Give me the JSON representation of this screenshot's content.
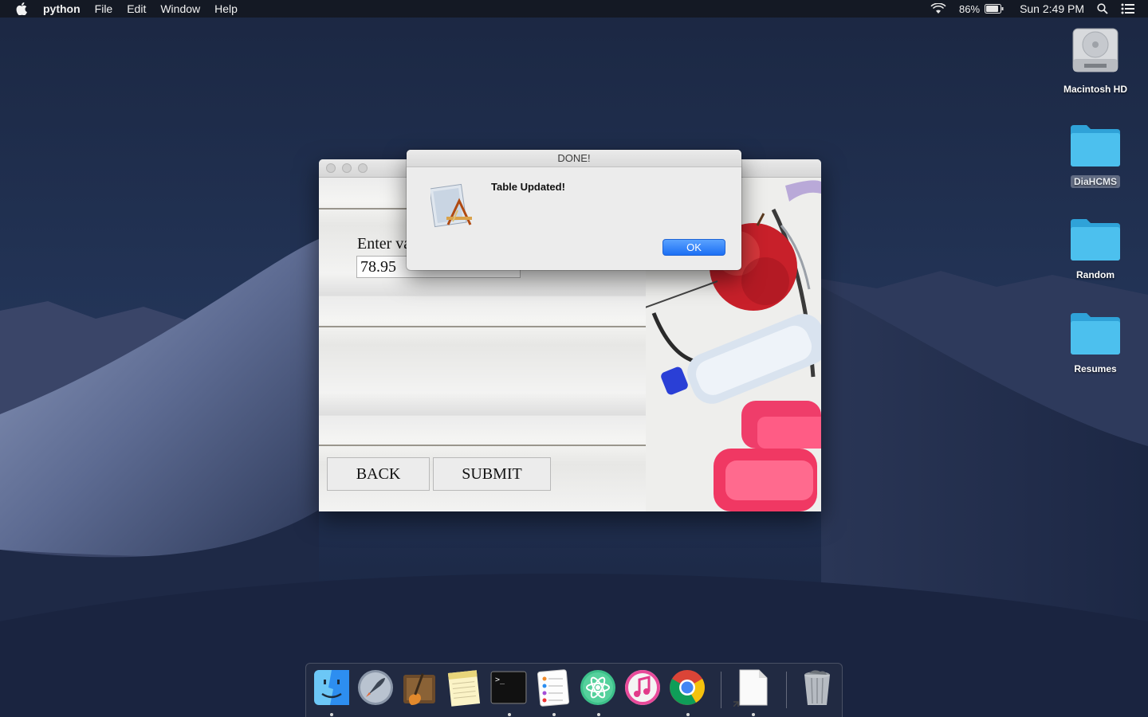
{
  "menubar": {
    "app_name": "python",
    "menus": [
      "File",
      "Edit",
      "Window",
      "Help"
    ],
    "battery": "86%",
    "clock": "Sun 2:49 PM"
  },
  "desktop": {
    "icons": [
      {
        "label": "Macintosh HD",
        "icon": "hard-drive-icon"
      },
      {
        "label": "DiaHCMS",
        "icon": "folder-icon"
      },
      {
        "label": "Random",
        "icon": "folder-icon"
      },
      {
        "label": "Resumes",
        "icon": "folder-icon"
      }
    ]
  },
  "app_window": {
    "enter_label": "Enter va",
    "value": "78.95",
    "back_label": "BACK",
    "submit_label": "SUBMIT"
  },
  "dialog": {
    "title": "DONE!",
    "message": "Table Updated!",
    "ok_label": "OK"
  },
  "dock": {
    "apps": [
      "finder-icon",
      "launchpad-icon",
      "garageband-icon",
      "notes-icon",
      "terminal-icon",
      "reminders-icon",
      "atom-icon",
      "itunes-icon",
      "chrome-icon",
      "document-icon",
      "trash-icon"
    ]
  },
  "colors": {
    "accent": "#1c6ff4",
    "folder": "#3fb6e8",
    "wallpaper": "#223250"
  }
}
